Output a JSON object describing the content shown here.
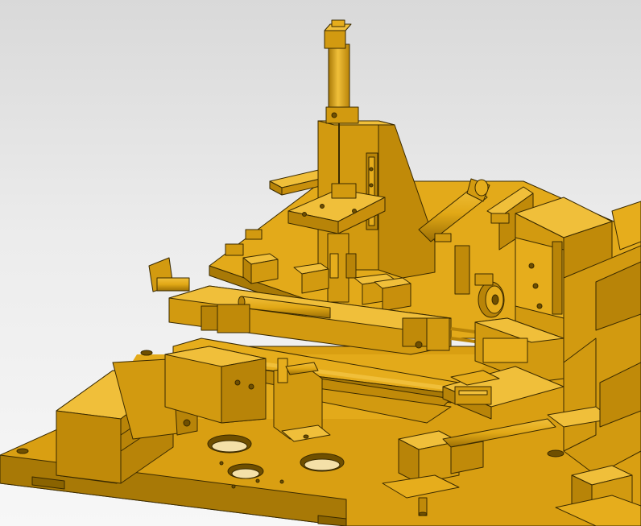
{
  "scene": {
    "subject": "",
    "colors": {
      "background_top": "#d9d9d9",
      "background_bottom": "#f7f7f7",
      "part_light": "#e6ad1c",
      "part_mid": "#d29a10",
      "part_dark": "#a87906",
      "part_shadow": "#6f4f00",
      "edge": "#3a2a00",
      "hole": "#f4e0a8"
    }
  }
}
